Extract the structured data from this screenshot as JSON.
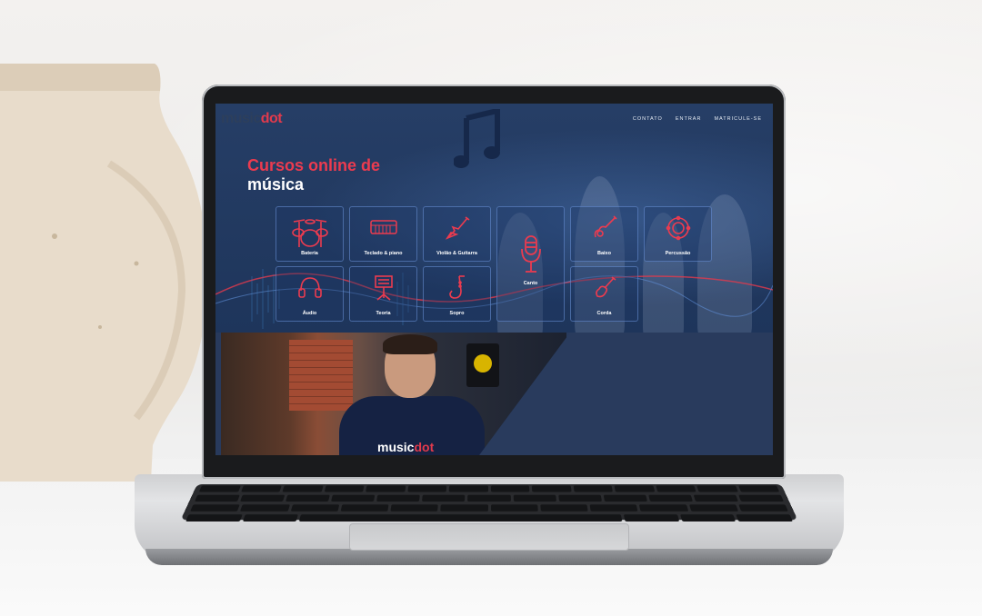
{
  "site": {
    "logo": {
      "part1": "music",
      "part2": "dot"
    },
    "nav": [
      "CONTATO",
      "ENTRAR",
      "MATRICULE-SE"
    ],
    "headline": {
      "line1": "Cursos online de",
      "line2": "música"
    },
    "courses": [
      {
        "label": "Bateria",
        "icon": "drum-kit-icon"
      },
      {
        "label": "Teclado & piano",
        "icon": "keyboard-icon"
      },
      {
        "label": "Violão & Guitarra",
        "icon": "electric-guitar-icon"
      },
      {
        "label": "Canto",
        "icon": "microphone-icon"
      },
      {
        "label": "Baixo",
        "icon": "bass-guitar-icon"
      },
      {
        "label": "Percussão",
        "icon": "tambourine-icon"
      },
      {
        "label": "Áudio",
        "icon": "headphones-icon"
      },
      {
        "label": "Teoria",
        "icon": "music-stand-icon"
      },
      {
        "label": "Sopro",
        "icon": "saxophone-icon"
      },
      {
        "label": "Corda",
        "icon": "violin-icon"
      }
    ],
    "video": {
      "shirt_logo_part1": "music",
      "shirt_logo_part2": "dot"
    }
  },
  "colors": {
    "accent": "#ec3b4f",
    "background": "#1f3356",
    "card_border": "#6e96dc"
  }
}
